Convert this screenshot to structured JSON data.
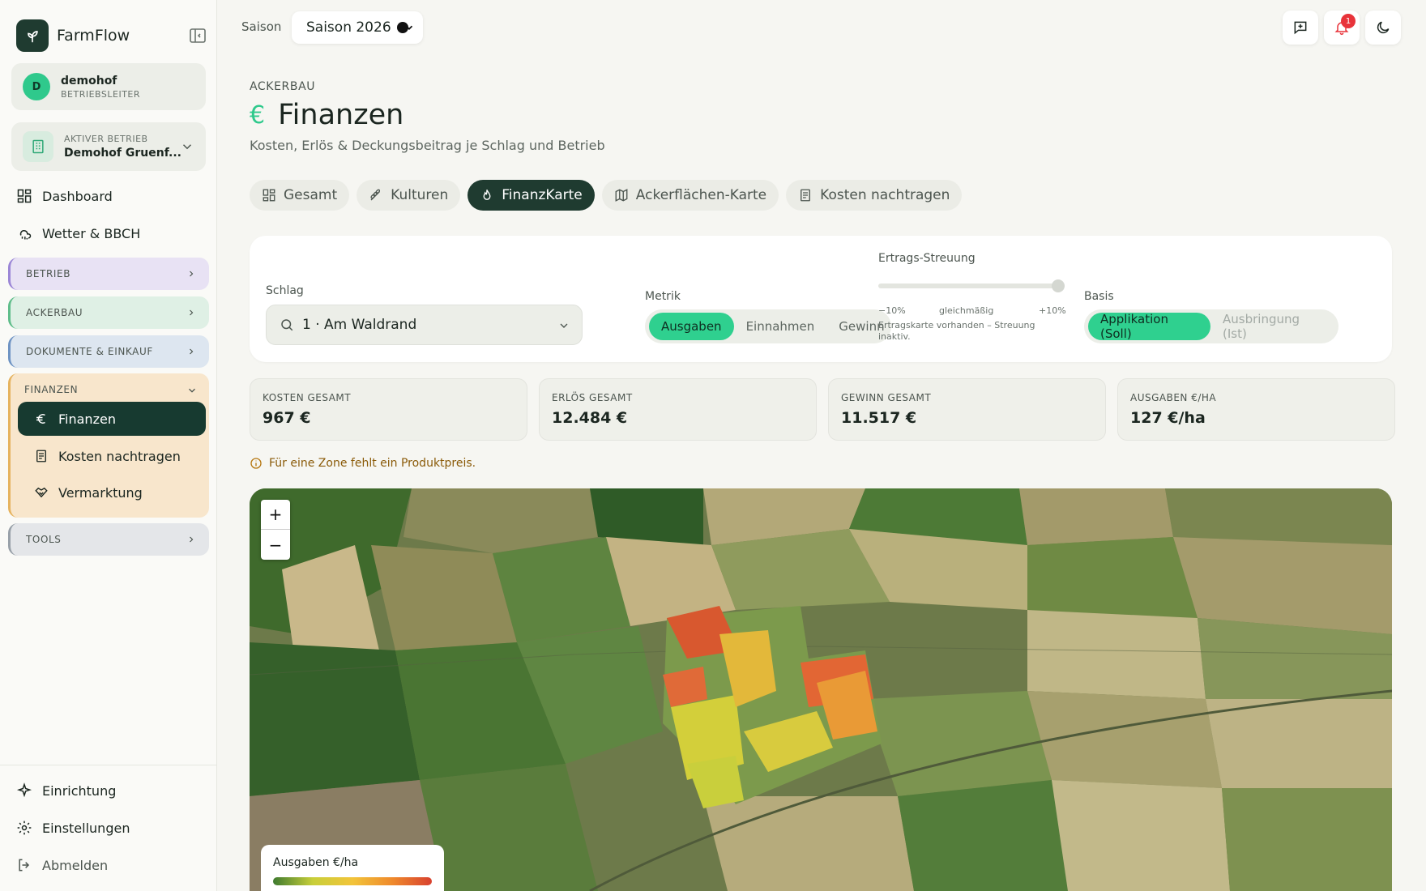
{
  "app": {
    "name": "FarmFlow"
  },
  "user": {
    "initial": "D",
    "name": "demohof",
    "role": "BETRIEBSLEITER"
  },
  "farm": {
    "label": "AKTIVER BETRIEB",
    "name": "Demohof Gruenf..."
  },
  "nav": {
    "dashboard": "Dashboard",
    "weather": "Wetter & BBCH"
  },
  "groups": {
    "betrieb": "BETRIEB",
    "ackerbau": "ACKERBAU",
    "dokumente": "DOKUMENTE & EINKAUF",
    "finanzen": "FINANZEN",
    "tools": "TOOLS"
  },
  "finance_items": {
    "finanzen": "Finanzen",
    "kosten": "Kosten nachtragen",
    "vermarktung": "Vermarktung"
  },
  "bottom_nav": {
    "setup": "Einrichtung",
    "settings": "Einstellungen",
    "logout": "Abmelden"
  },
  "topbar": {
    "season_label": "Saison",
    "season_value": "Saison 2026",
    "notification_count": "1"
  },
  "header": {
    "overline": "ACKERBAU",
    "currency_symbol": "€",
    "title": "Finanzen",
    "subtitle": "Kosten, Erlös & Deckungsbeitrag je Schlag und Betrieb"
  },
  "tabs": [
    "Gesamt",
    "Kulturen",
    "FinanzKarte",
    "Ackerflächen-Karte",
    "Kosten nachtragen"
  ],
  "active_tab": "FinanzKarte",
  "filters": {
    "schlag_label": "Schlag",
    "schlag_value": "1 · Am Waldrand",
    "metric_label": "Metrik",
    "metrics": [
      "Ausgaben",
      "Einnahmen",
      "Gewinn"
    ],
    "metric_active": "Ausgaben",
    "streuung_label": "Ertrags-Streuung",
    "streuung_min": "−10%",
    "streuung_mid": "gleichmäßig",
    "streuung_max": "+10%",
    "streuung_note": "Ertragskarte vorhanden – Streuung inaktiv.",
    "basis_label": "Basis",
    "basis_options": [
      "Applikation (Soll)",
      "Ausbringung (Ist)"
    ],
    "basis_active": "Applikation (Soll)"
  },
  "stats": [
    {
      "label": "KOSTEN GESAMT",
      "value": "967 €"
    },
    {
      "label": "ERLÖS GESAMT",
      "value": "12.484 €"
    },
    {
      "label": "GEWINN GESAMT",
      "value": "11.517 €"
    },
    {
      "label": "AUSGABEN €/HA",
      "value": "127 €/ha"
    }
  ],
  "warning": "Für eine Zone fehlt ein Produktpreis.",
  "map": {
    "zoom_in": "+",
    "zoom_out": "−",
    "legend_title": "Ausgaben €/ha"
  },
  "colors": {
    "accent": "#2fd08f",
    "dark": "#1f3b30",
    "warning": "#8a5a08",
    "scale_low": "#3e7a2f",
    "scale_mid": "#f2c43a",
    "scale_high": "#d8412f"
  }
}
